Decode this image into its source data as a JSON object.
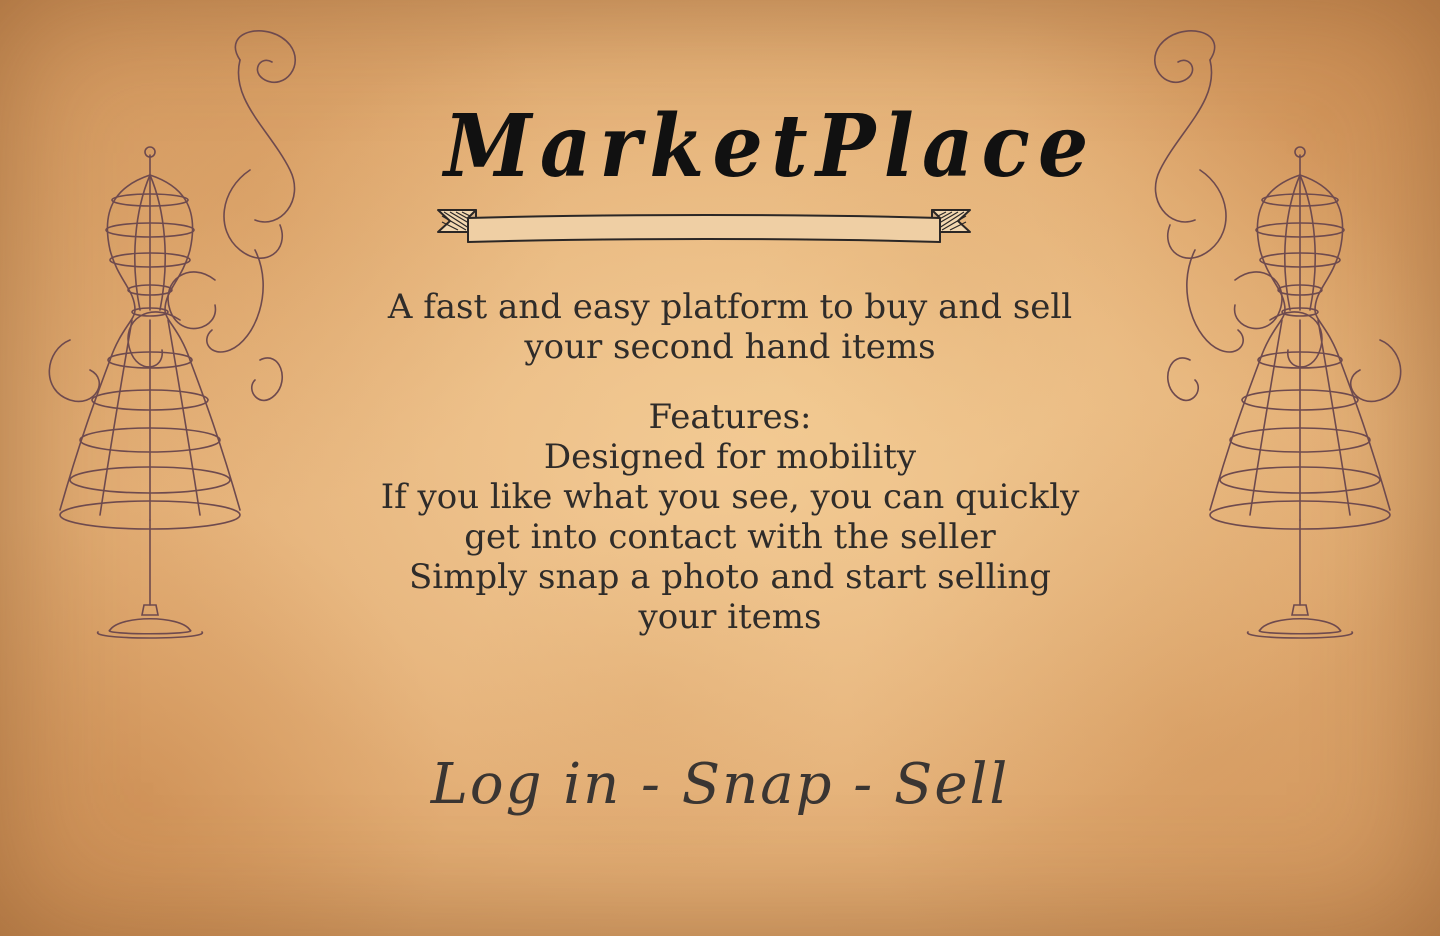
{
  "brand": {
    "title": "MarketPlace"
  },
  "tagline": {
    "line1": "A fast and easy platform to buy and sell",
    "line2": "your second hand items"
  },
  "features": {
    "heading": "Features:",
    "lines": [
      "Designed for mobility",
      "If you like what you see, you can quickly",
      "get into contact with the seller",
      "Simply snap a photo and start selling",
      "your items"
    ]
  },
  "slogan": "Log in - Snap - Sell",
  "icons": {
    "left": "dress-form-icon",
    "right": "dress-form-icon",
    "title_ribbon": "ribbon-banner-icon"
  },
  "colors": {
    "paper": "#e2ad74",
    "ink": "#2f2c2a",
    "title": "#111111",
    "sketch": "#6e4a4e"
  }
}
